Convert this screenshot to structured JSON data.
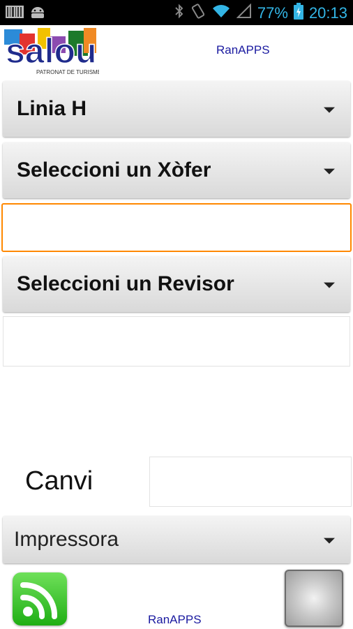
{
  "status_bar": {
    "battery_percent": "77%",
    "time": "20:13",
    "icons": [
      "barcode-icon",
      "android-icon",
      "bluetooth-icon",
      "vibrate-icon",
      "wifi-icon",
      "signal-icon",
      "battery-charging-icon"
    ]
  },
  "header": {
    "logo_text": "salou",
    "logo_subtitle": "PATRONAT DE TURISME",
    "brand": "RanAPPS"
  },
  "form": {
    "line_spinner": "Linia H",
    "driver_spinner": "Seleccioni un Xòfer",
    "driver_input_value": "",
    "inspector_spinner": "Seleccioni un Revisor",
    "inspector_input_value": "",
    "change_label": "Canvi",
    "change_input_value": "",
    "printer_spinner": "Impressora"
  },
  "footer": {
    "brand": "RanAPPS"
  },
  "colors": {
    "accent_orange": "#ff8800",
    "status_blue": "#33b5e5",
    "link_blue": "#1a1aa0",
    "rss_green": "#3cc82a"
  }
}
